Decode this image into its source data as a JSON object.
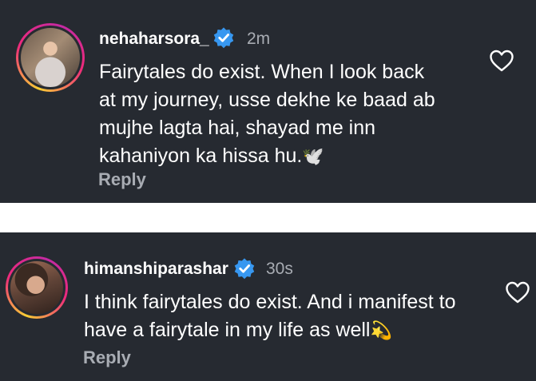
{
  "comments": [
    {
      "username": "nehaharsora_",
      "time": "2m",
      "lines": [
        "Fairytales do exist. When I look  back",
        "at my journey, usse dekhe ke baad ab",
        "mujhe lagta hai, shayad me inn",
        "kahaniyon ka hissa hu."
      ],
      "emoji": "🕊️",
      "reply_label": "Reply"
    },
    {
      "username": "himanshiparashar",
      "time": "30s",
      "lines": [
        "I think fairytales do exist. And i manifest to",
        "have a fairytale in my life as well"
      ],
      "emoji": "💫",
      "reply_label": "Reply"
    }
  ],
  "colors": {
    "panel_bg": "#262a31",
    "verified_badge": "#3797f0",
    "muted_text": "#a8acb3"
  },
  "icons": {
    "verified": "verified-badge-icon",
    "like": "heart-outline-icon"
  }
}
